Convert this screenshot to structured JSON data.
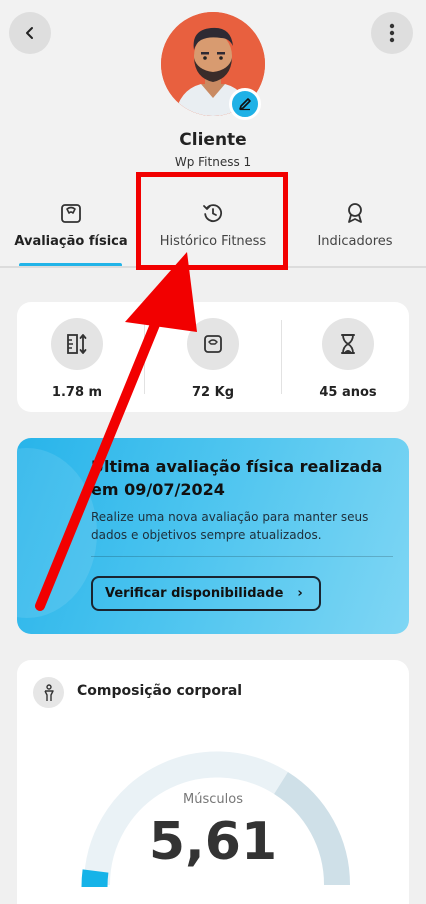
{
  "header": {
    "client_name": "Cliente",
    "gym_name": "Wp Fitness 1"
  },
  "tabs": [
    {
      "label": "Avaliação física",
      "icon": "scale-icon",
      "active": true
    },
    {
      "label": "Histórico Fitness",
      "icon": "history-icon",
      "active": false
    },
    {
      "label": "Indicadores",
      "icon": "award-icon",
      "active": false
    }
  ],
  "stats": [
    {
      "value": "1.78 m",
      "icon": "height-icon"
    },
    {
      "value": "72 Kg",
      "icon": "weight-scale-icon"
    },
    {
      "value": "45 anos",
      "icon": "hourglass-icon"
    }
  ],
  "evaluation": {
    "title": "Última avaliação física realizada em  09/07/2024",
    "description": "Realize uma nova avaliação para manter seus dados e objetivos sempre atualizados.",
    "button_label": "Verificar disponibilidade",
    "button_icon": "chevron-right-icon"
  },
  "composition": {
    "title": "Composição corporal",
    "gauge_label": "Músculos",
    "gauge_value": "5,61",
    "icon": "body-icon"
  },
  "colors": {
    "accent": "#22b4e8",
    "annotation": "#f20000"
  }
}
